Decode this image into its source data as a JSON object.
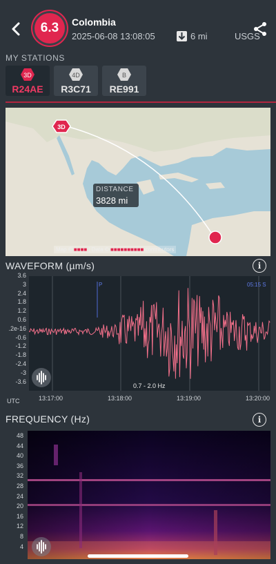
{
  "header": {
    "magnitude": "6.3",
    "place": "Colombia",
    "datetime": "2025-06-08 13:08:05",
    "depth": "6 mi",
    "source": "USGS"
  },
  "stations": {
    "title": "MY STATIONS",
    "items": [
      {
        "badge": "3D",
        "name": "R24AE",
        "active": true
      },
      {
        "badge": "4D",
        "name": "R3C71",
        "active": false
      },
      {
        "badge": "B",
        "name": "RE991",
        "active": false
      }
    ]
  },
  "map": {
    "station_marker": "3D",
    "distance_label": "DISTANCE",
    "distance_value": "3828 mi",
    "attribution_prefix": "Map ©",
    "attribution_data": "| Data ©",
    "attribution_suffix": "contributors"
  },
  "waveform": {
    "title": "WAVEFORM (µm/s)",
    "y_ticks": [
      "3.6",
      "3",
      "2.4",
      "1.8",
      "1.2",
      "0.6",
      ".2e-16",
      "-0.6",
      "-1.2",
      "-1.8",
      "-2.4",
      "-3",
      "-3.6"
    ],
    "x_ticks": [
      "13:17:00",
      "13:18:00",
      "13:19:00",
      "13:20:00"
    ],
    "x_unit": "UTC",
    "p_marker": "P",
    "s_marker": "05:15  S",
    "filter": "0.7 - 2.0 Hz"
  },
  "frequency": {
    "title": "FREQUENCY (Hz)",
    "y_ticks": [
      "48",
      "44",
      "40",
      "36",
      "32",
      "28",
      "24",
      "20",
      "16",
      "12",
      "8",
      "4"
    ]
  },
  "colors": {
    "accent": "#e0264f",
    "waveform_line": "#f2708a",
    "background": "#2d343b"
  }
}
